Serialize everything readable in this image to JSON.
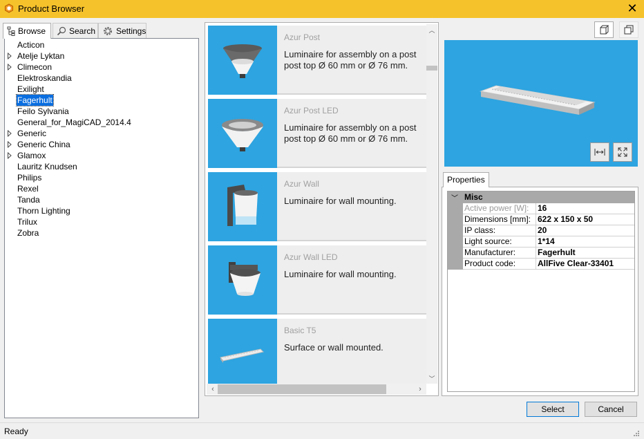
{
  "window": {
    "title": "Product Browser"
  },
  "tabs": [
    {
      "label": "Browse"
    },
    {
      "label": "Search"
    },
    {
      "label": "Settings"
    }
  ],
  "tree": {
    "items": [
      {
        "label": "Acticon",
        "expandable": false
      },
      {
        "label": "Atelje Lyktan",
        "expandable": true
      },
      {
        "label": "Climecon",
        "expandable": true
      },
      {
        "label": "Elektroskandia",
        "expandable": false
      },
      {
        "label": "Exilight",
        "expandable": false
      },
      {
        "label": "Fagerhult",
        "expandable": false,
        "selected": true
      },
      {
        "label": "Feilo Sylvania",
        "expandable": false
      },
      {
        "label": "General_for_MagiCAD_2014.4",
        "expandable": false
      },
      {
        "label": "Generic",
        "expandable": true
      },
      {
        "label": "Generic China",
        "expandable": true
      },
      {
        "label": "Glamox",
        "expandable": true
      },
      {
        "label": "Lauritz Knudsen",
        "expandable": false
      },
      {
        "label": "Philips",
        "expandable": false
      },
      {
        "label": "Rexel",
        "expandable": false
      },
      {
        "label": "Tanda",
        "expandable": false
      },
      {
        "label": "Thorn Lighting",
        "expandable": false
      },
      {
        "label": "Trilux",
        "expandable": false
      },
      {
        "label": "Zobra",
        "expandable": false
      }
    ]
  },
  "products": [
    {
      "name": "Azur Post",
      "description": "Luminaire for assembly on a post\npost top Ø 60 mm or Ø 76 mm.",
      "thumb_icon": "post-top-luminaire-icon"
    },
    {
      "name": "Azur Post LED",
      "description": "Luminaire for assembly on a post\npost top Ø 60 mm or Ø 76 mm.",
      "thumb_icon": "post-top-led-luminaire-icon"
    },
    {
      "name": "Azur Wall",
      "description": "Luminaire for wall mounting.",
      "thumb_icon": "wall-luminaire-icon"
    },
    {
      "name": "Azur Wall LED",
      "description": "Luminaire for wall mounting.",
      "thumb_icon": "wall-led-luminaire-icon"
    },
    {
      "name": "Basic T5",
      "description": "Surface or wall mounted.",
      "thumb_icon": "linear-t5-luminaire-icon"
    }
  ],
  "properties": {
    "tab_label": "Properties",
    "category": "Misc",
    "rows": [
      {
        "name": "Active power [W]:",
        "value": "16"
      },
      {
        "name": "Dimensions [mm]:",
        "value": "622 x 150 x 50"
      },
      {
        "name": "IP class:",
        "value": "20"
      },
      {
        "name": "Light source:",
        "value": "1*14"
      },
      {
        "name": "Manufacturer:",
        "value": "Fagerhult"
      },
      {
        "name": "Product code:",
        "value": "AllFive Clear-33401"
      }
    ]
  },
  "buttons": {
    "select": "Select",
    "cancel": "Cancel"
  },
  "status": {
    "text": "Ready"
  },
  "colors": {
    "titlebar": "#f6c22b",
    "thumb_bg": "#2ea4e0",
    "selection": "#0a6ee0"
  }
}
